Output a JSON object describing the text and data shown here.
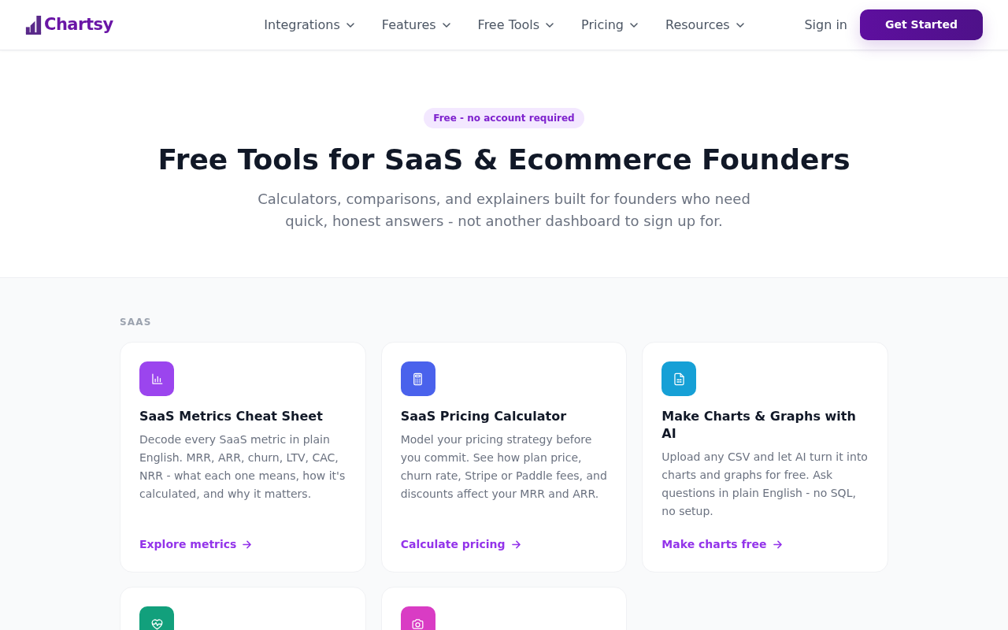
{
  "nav": {
    "brand": "Chartsy",
    "links": [
      {
        "label": "Integrations"
      },
      {
        "label": "Features"
      },
      {
        "label": "Free Tools"
      },
      {
        "label": "Pricing"
      },
      {
        "label": "Resources"
      }
    ],
    "sign_in": "Sign in",
    "cta": "Get Started"
  },
  "hero": {
    "badge": "Free - no account required",
    "title": "Free Tools for SaaS & Ecommerce Founders",
    "subtitle": "Calculators, comparisons, and explainers built for founders who need quick, honest answers - not another dashboard to sign up for."
  },
  "sections": [
    {
      "heading": "SAAS",
      "cards": [
        {
          "color": "#9b45ee",
          "title": "SaaS Metrics Cheat Sheet",
          "description": "Decode every SaaS metric in plain English. MRR, ARR, churn, LTV, CAC, NRR - what each one means, how it's calculated, and why it matters.",
          "link": "Explore metrics"
        },
        {
          "color": "#4a62ec",
          "title": "SaaS Pricing Calculator",
          "description": "Model your pricing strategy before you commit. See how plan price, churn rate, Stripe or Paddle fees, and discounts affect your MRR and ARR.",
          "link": "Calculate pricing"
        },
        {
          "color": "#16a0d6",
          "title": "Make Charts & Graphs with AI",
          "description": "Upload any CSV and let AI turn it into charts and graphs for free. Ask questions in plain English - no SQL, no setup.",
          "link": "Make charts free"
        },
        {
          "color": "#12a07c"
        },
        {
          "color": "#d93cc4"
        }
      ]
    }
  ]
}
